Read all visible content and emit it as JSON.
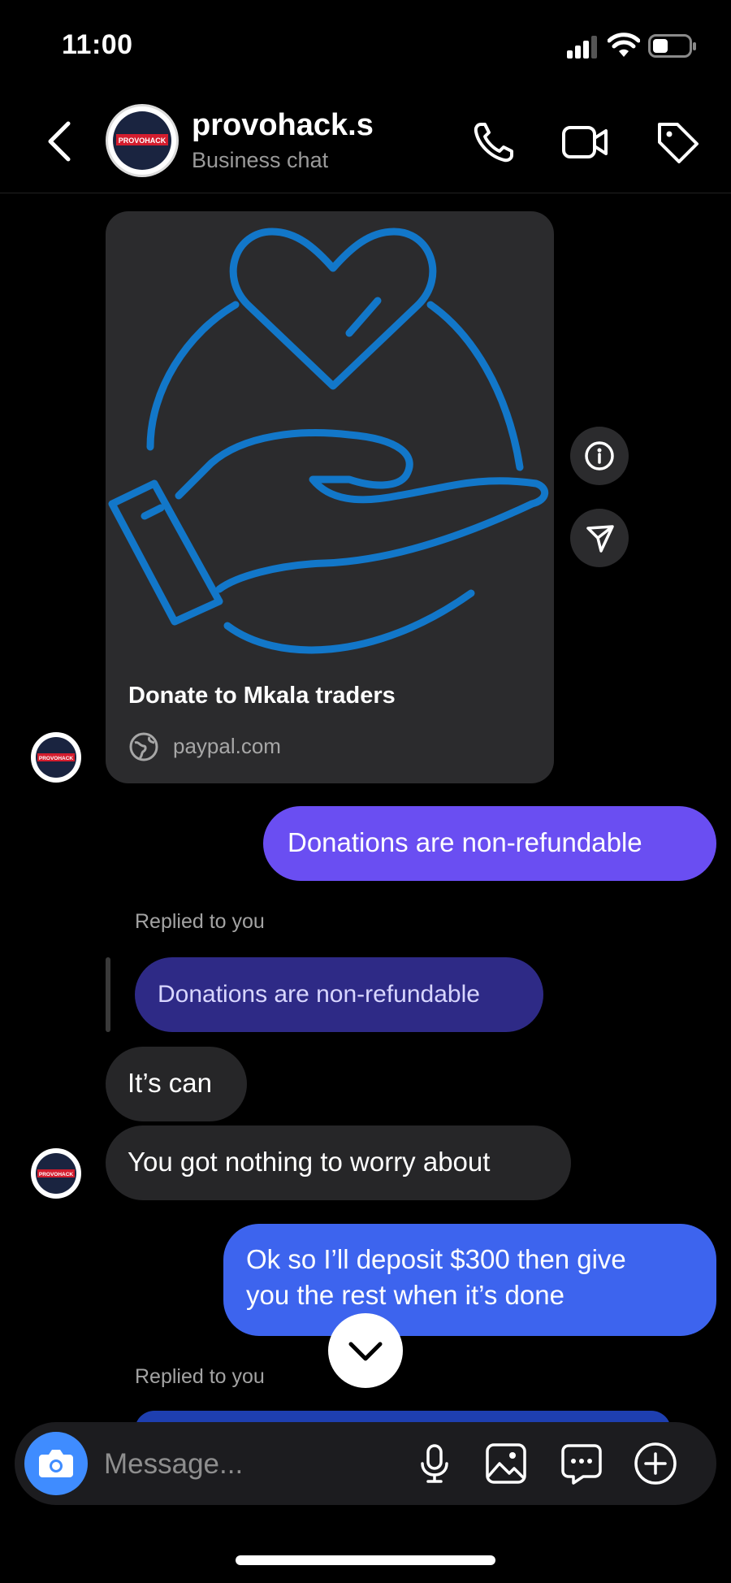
{
  "status": {
    "time": "11:00"
  },
  "header": {
    "name": "provohack.s",
    "subtitle": "Business chat",
    "avatar_text": "PROVOHACK"
  },
  "link_card": {
    "title": "Donate to Mkala traders",
    "domain": "paypal.com",
    "accent": "#1277c9"
  },
  "messages": {
    "out_1": "Donations are non-refundable",
    "reply_label_1": "Replied to you",
    "quoted_1": "Donations are non-refundable",
    "in_1": "It’s can",
    "in_2": "You got nothing to worry about",
    "out_2_line1": "Ok so I’ll deposit $300 then give",
    "out_2_line2": "you the rest when it’s done",
    "reply_label_2": "Replied to you"
  },
  "composer": {
    "placeholder": "Message..."
  },
  "colors": {
    "outgoing": "#6a4ef2",
    "outgoing_blue": "#3d64ee",
    "incoming": "#262628",
    "quote": "#2e2a86",
    "camera": "#3f8cff"
  },
  "icons": [
    "back-chevron-icon",
    "phone-icon",
    "video-camera-icon",
    "tag-icon",
    "info-icon",
    "share-icon",
    "globe-icon",
    "chevron-down-icon",
    "camera-icon",
    "microphone-icon",
    "gallery-icon",
    "sticker-chat-icon",
    "plus-circle-icon"
  ]
}
